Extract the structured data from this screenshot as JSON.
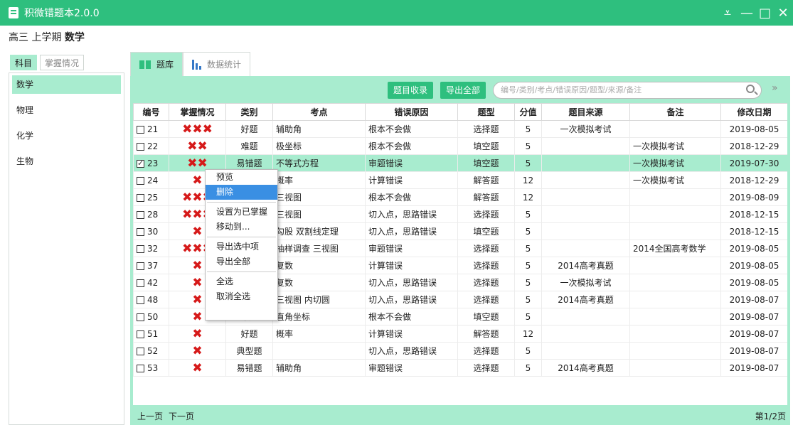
{
  "window": {
    "title": "积微错题本2.0.0",
    "min": "—",
    "max": "□",
    "close": "✕",
    "menu": "⩡"
  },
  "header": {
    "grade": "高三 上学期",
    "subject": "数学"
  },
  "left_tabs": [
    {
      "label": "科目"
    },
    {
      "label": "掌握情况"
    }
  ],
  "subjects": [
    {
      "label": "数学"
    },
    {
      "label": "物理"
    },
    {
      "label": "化学"
    },
    {
      "label": "生物"
    }
  ],
  "right_tabs": [
    {
      "label": "题库"
    },
    {
      "label": "数据统计"
    }
  ],
  "toolbar": {
    "collect": "题目收录",
    "export_all": "导出全部",
    "search_placeholder": "编号/类别/考点/错误原因/题型/来源/备注",
    "expand": "»"
  },
  "table": {
    "headers": [
      "编号",
      "掌握情况",
      "类别",
      "考点",
      "错误原因",
      "题型",
      "分值",
      "题目来源",
      "备注",
      "修改日期"
    ],
    "rows": [
      {
        "checked": false,
        "id": "21",
        "mastery": "✖✖✖",
        "category": "好题",
        "topic": "辅助角",
        "reason": "根本不会做",
        "type": "选择题",
        "score": "5",
        "source": "一次模拟考试",
        "note": "",
        "date": "2019-08-05"
      },
      {
        "checked": false,
        "id": "22",
        "mastery": "✖✖",
        "category": "难题",
        "topic": "极坐标",
        "reason": "根本不会做",
        "type": "填空题",
        "score": "5",
        "source": "",
        "note": "一次模拟考试",
        "date": "2018-12-29"
      },
      {
        "checked": true,
        "id": "23",
        "mastery": "✖✖",
        "category": "易错题",
        "topic": "不等式方程",
        "reason": "审题错误",
        "type": "填空题",
        "score": "5",
        "source": "",
        "note": "一次模拟考试",
        "date": "2019-07-30"
      },
      {
        "checked": false,
        "id": "24",
        "mastery": "✖",
        "category": "",
        "topic": "概率",
        "reason": "计算错误",
        "type": "解答题",
        "score": "12",
        "source": "",
        "note": "一次模拟考试",
        "date": "2018-12-29"
      },
      {
        "checked": false,
        "id": "25",
        "mastery": "✖✖✖",
        "category": "",
        "topic": "三视图",
        "reason": "根本不会做",
        "type": "解答题",
        "score": "12",
        "source": "",
        "note": "",
        "date": "2019-08-09"
      },
      {
        "checked": false,
        "id": "28",
        "mastery": "✖✖✖",
        "category": "",
        "topic": "三视图",
        "reason": "切入点，思路错误",
        "type": "选择题",
        "score": "5",
        "source": "",
        "note": "",
        "date": "2018-12-15"
      },
      {
        "checked": false,
        "id": "30",
        "mastery": "✖",
        "category": "",
        "topic": "勾股 双割线定理",
        "reason": "切入点，思路错误",
        "type": "填空题",
        "score": "5",
        "source": "",
        "note": "",
        "date": "2018-12-15"
      },
      {
        "checked": false,
        "id": "32",
        "mastery": "✖✖✖",
        "category": "",
        "topic": "抽样调查 三视图",
        "reason": "审题错误",
        "type": "选择题",
        "score": "5",
        "source": "",
        "note": "2014全国高考数学",
        "date": "2019-08-05"
      },
      {
        "checked": false,
        "id": "37",
        "mastery": "✖",
        "category": "",
        "topic": "复数",
        "reason": "计算错误",
        "type": "选择题",
        "score": "5",
        "source": "2014高考真题",
        "note": "",
        "date": "2019-08-05"
      },
      {
        "checked": false,
        "id": "42",
        "mastery": "✖",
        "category": "",
        "topic": "复数",
        "reason": "切入点，思路错误",
        "type": "选择题",
        "score": "5",
        "source": "一次模拟考试",
        "note": "",
        "date": "2019-08-05"
      },
      {
        "checked": false,
        "id": "48",
        "mastery": "✖",
        "category": "典型题",
        "topic": "三视图 内切圆",
        "reason": "切入点，思路错误",
        "type": "选择题",
        "score": "5",
        "source": "2014高考真题",
        "note": "",
        "date": "2019-08-07"
      },
      {
        "checked": false,
        "id": "50",
        "mastery": "✖",
        "category": "难题",
        "topic": "直角坐标",
        "reason": "根本不会做",
        "type": "填空题",
        "score": "5",
        "source": "",
        "note": "",
        "date": "2019-08-07"
      },
      {
        "checked": false,
        "id": "51",
        "mastery": "✖",
        "category": "好题",
        "topic": "概率",
        "reason": "计算错误",
        "type": "解答题",
        "score": "12",
        "source": "",
        "note": "",
        "date": "2019-08-07"
      },
      {
        "checked": false,
        "id": "52",
        "mastery": "✖",
        "category": "典型题",
        "topic": "",
        "reason": "切入点，思路错误",
        "type": "选择题",
        "score": "5",
        "source": "",
        "note": "",
        "date": "2019-08-07"
      },
      {
        "checked": false,
        "id": "53",
        "mastery": "✖",
        "category": "易错题",
        "topic": "辅助角",
        "reason": "审题错误",
        "type": "选择题",
        "score": "5",
        "source": "2014高考真题",
        "note": "",
        "date": "2019-08-07"
      }
    ]
  },
  "footer": {
    "prev": "上一页",
    "next": "下一页",
    "page_info": "第1/2页"
  },
  "context_menu": {
    "items": [
      {
        "label": "预览",
        "group": 1
      },
      {
        "label": "删除",
        "group": 1,
        "highlighted": true
      },
      {
        "label": "设置为已掌握",
        "group": 2
      },
      {
        "label": "移动到...",
        "group": 2
      },
      {
        "label": "导出选中项",
        "group": 3
      },
      {
        "label": "导出全部",
        "group": 3
      },
      {
        "label": "全选",
        "group": 4
      },
      {
        "label": "取消全选",
        "group": 4
      }
    ]
  },
  "colors": {
    "brand": "#2ebf7e",
    "selected": "#a8eccf",
    "mastery_x": "#d61a1a",
    "menu_highlight": "#3a8fe3"
  }
}
